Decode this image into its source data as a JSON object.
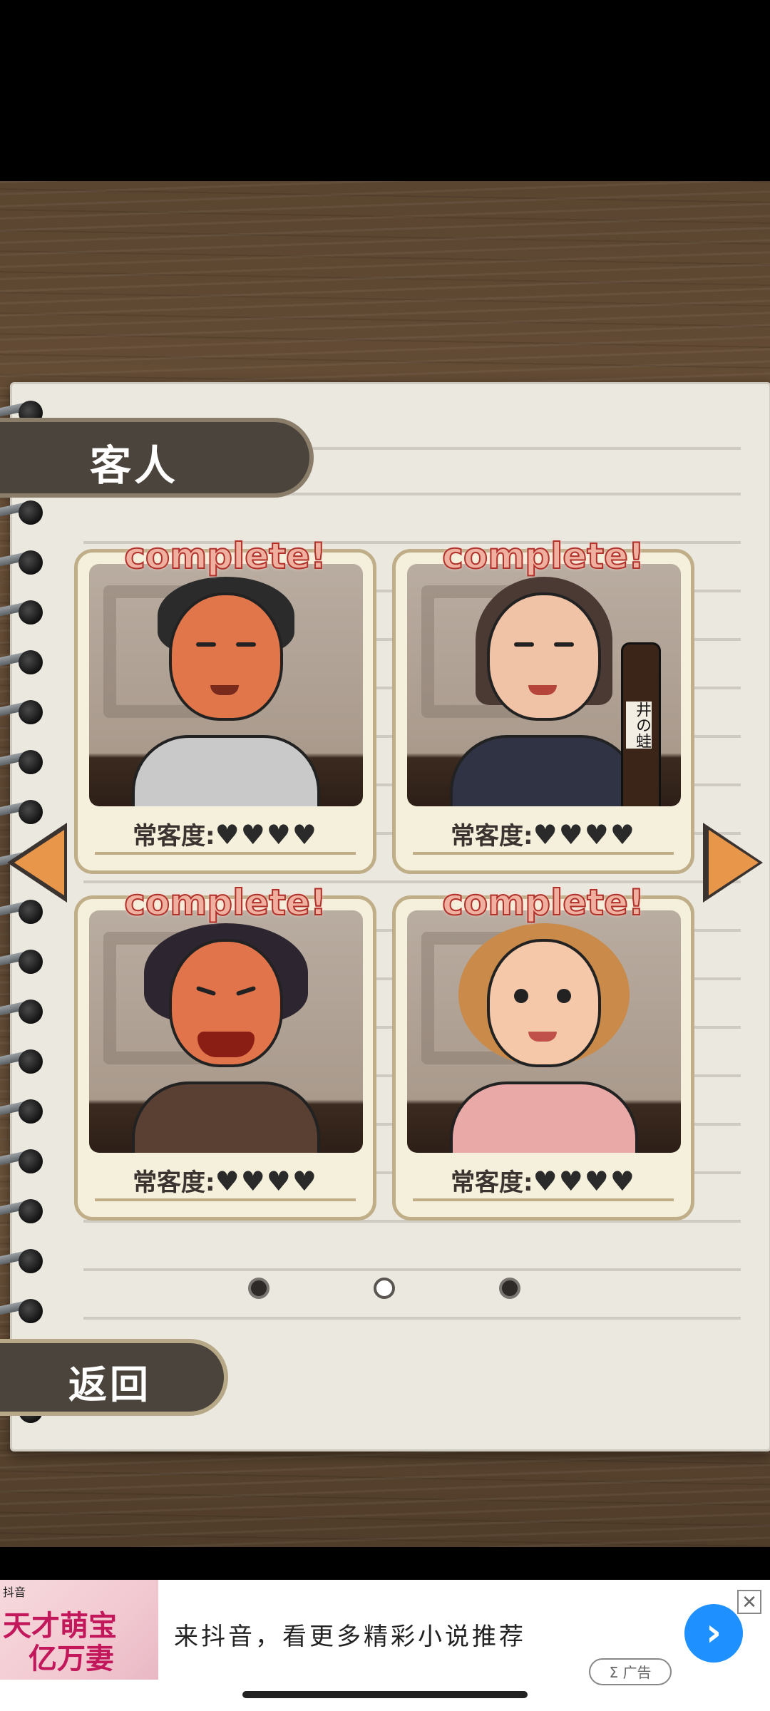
{
  "header": {
    "title": "客人"
  },
  "cards": [
    {
      "status": "complete!",
      "loyalty_label": "常客度:",
      "hearts": "♥♥♥♥",
      "hearts_count": 4,
      "character": "man-gray-hoodie"
    },
    {
      "status": "complete!",
      "loyalty_label": "常客度:",
      "hearts": "♥♥♥♥",
      "hearts_count": 4,
      "character": "woman-ponytail-bottle",
      "bottle_label": "井の蛙"
    },
    {
      "status": "complete!",
      "loyalty_label": "常客度:",
      "hearts": "♥♥♥♥",
      "hearts_count": 4,
      "character": "angry-woman-curly"
    },
    {
      "status": "complete!",
      "loyalty_label": "常客度:",
      "hearts": "♥♥♥♥",
      "hearts_count": 4,
      "character": "crying-woman-blonde"
    }
  ],
  "pager": {
    "current_page": 2,
    "total_pages": 3
  },
  "back_button": {
    "label": "返回"
  },
  "ad": {
    "thumb_line1": "天才萌宝",
    "thumb_line2": "亿万妻",
    "thumb_logo": "抖音",
    "text": "来抖音，看更多精彩小说推荐",
    "tag": "Σ 广告",
    "close": "✕",
    "go": "›"
  },
  "colors": {
    "accent_arrow": "#e8964a",
    "tab_bg": "#4b443c",
    "complete_text": "#b0302a"
  }
}
